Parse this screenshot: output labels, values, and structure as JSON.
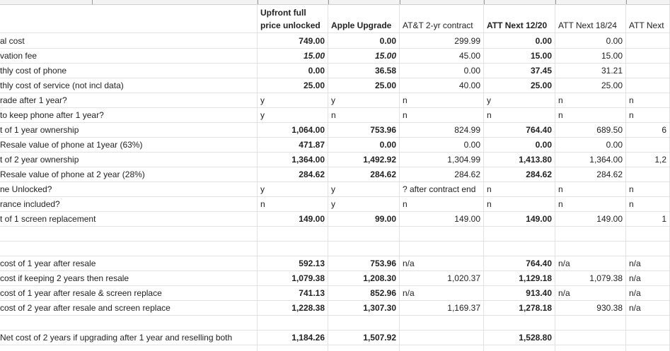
{
  "headers": [
    {
      "key": "c1",
      "lines": [
        "Upfront full",
        "price unlocked"
      ],
      "bold": true
    },
    {
      "key": "c2",
      "lines": [
        "",
        "Apple Upgrade"
      ],
      "bold": true
    },
    {
      "key": "c3",
      "lines": [
        "",
        "AT&T 2-yr contract"
      ],
      "bold": false
    },
    {
      "key": "c4",
      "lines": [
        "",
        "ATT Next 12/20"
      ],
      "bold": true
    },
    {
      "key": "c5",
      "lines": [
        "",
        "ATT Next 18/24"
      ],
      "bold": false
    },
    {
      "key": "c6",
      "lines": [
        "",
        "ATT Next"
      ],
      "bold": false
    }
  ],
  "rows": [
    {
      "label": "al cost",
      "cells": {
        "c1": "749.00",
        "c2": "0.00",
        "c3": "299.99",
        "c4": "0.00",
        "c5": "0.00"
      }
    },
    {
      "label": "vation fee",
      "cells": {
        "c1": "15.00",
        "c2": "15.00",
        "c3": "45.00",
        "c4": "15.00",
        "c5": "15.00"
      }
    },
    {
      "label": "thly cost of phone",
      "cells": {
        "c1": "0.00",
        "c2": "36.58",
        "c3": "0.00",
        "c4": "37.45",
        "c5": "31.21"
      }
    },
    {
      "label": "thly cost of service (not incl data)",
      "cells": {
        "c1": "25.00",
        "c2": "25.00",
        "c3": "40.00",
        "c4": "25.00",
        "c5": "25.00"
      }
    },
    {
      "label": "rade after 1 year?",
      "cells": {
        "c1": "y",
        "c2": "y",
        "c3": "n",
        "c4": "y",
        "c5": "n",
        "c6": "n"
      }
    },
    {
      "label": "to keep phone after 1 year?",
      "cells": {
        "c1": "y",
        "c2": "n",
        "c3": "n",
        "c4": "n",
        "c5": "n",
        "c6": "n"
      }
    },
    {
      "label": "t of 1 year ownership",
      "cells": {
        "c1": "1,064.00",
        "c2": "753.96",
        "c3": "824.99",
        "c4": "764.40",
        "c5": "689.50",
        "c6": "6"
      }
    },
    {
      "label": " Resale value of phone at 1year (63%)",
      "cells": {
        "c1": "471.87",
        "c2": "0.00",
        "c3": "0.00",
        "c4": "0.00",
        "c5": "0.00"
      }
    },
    {
      "label": "t of 2 year ownership",
      "cells": {
        "c1": "1,364.00",
        "c2": "1,492.92",
        "c3": "1,304.99",
        "c4": "1,413.80",
        "c5": "1,364.00",
        "c6": "1,2"
      }
    },
    {
      "label": "Resale value of phone at 2 year (28%)",
      "cells": {
        "c1": "284.62",
        "c2": "284.62",
        "c3": "284.62",
        "c4": "284.62",
        "c5": "284.62"
      }
    },
    {
      "label": "ne Unlocked?",
      "cells": {
        "c1": "y",
        "c2": "y",
        "c3": "? after contract end",
        "c4": "n",
        "c5": "n",
        "c6": "n"
      }
    },
    {
      "label": "rance included?",
      "cells": {
        "c1": "n",
        "c2": "y",
        "c3": "n",
        "c4": "n",
        "c5": "n",
        "c6": "n"
      }
    },
    {
      "label": "t of 1 screen replacement",
      "cells": {
        "c1": "149.00",
        "c2": "99.00",
        "c3": "149.00",
        "c4": "149.00",
        "c5": "149.00",
        "c6": "1"
      }
    },
    {
      "label": "",
      "cells": {}
    },
    {
      "label": "",
      "cells": {}
    },
    {
      "label": "cost of 1 year after resale",
      "cells": {
        "c1": "592.13",
        "c2": "753.96",
        "c3": "n/a",
        "c4": "764.40",
        "c5": "n/a",
        "c6": "n/a"
      }
    },
    {
      "label": "cost if keeping 2 years then resale",
      "cells": {
        "c1": "1,079.38",
        "c2": "1,208.30",
        "c3": "1,020.37",
        "c4": "1,129.18",
        "c5": "1,079.38",
        "c6": "n/a"
      }
    },
    {
      "label": "cost of 1 year after resale & screen replace",
      "cells": {
        "c1": "741.13",
        "c2": "852.96",
        "c3": "n/a",
        "c4": "913.40",
        "c5": "n/a",
        "c6": "n/a"
      }
    },
    {
      "label": "cost of 2 year after resale and screen replace",
      "cells": {
        "c1": "1,228.38",
        "c2": "1,307.30",
        "c3": "1,169.37",
        "c4": "1,278.18",
        "c5": "930.38",
        "c6": "n/a"
      }
    },
    {
      "label": "",
      "cells": {}
    },
    {
      "label": "Net cost of 2 years if upgrading after 1 year and reselling both",
      "cells": {
        "c1": "1,184.26",
        "c2": "1,507.92",
        "c4": "1,528.80"
      }
    }
  ]
}
